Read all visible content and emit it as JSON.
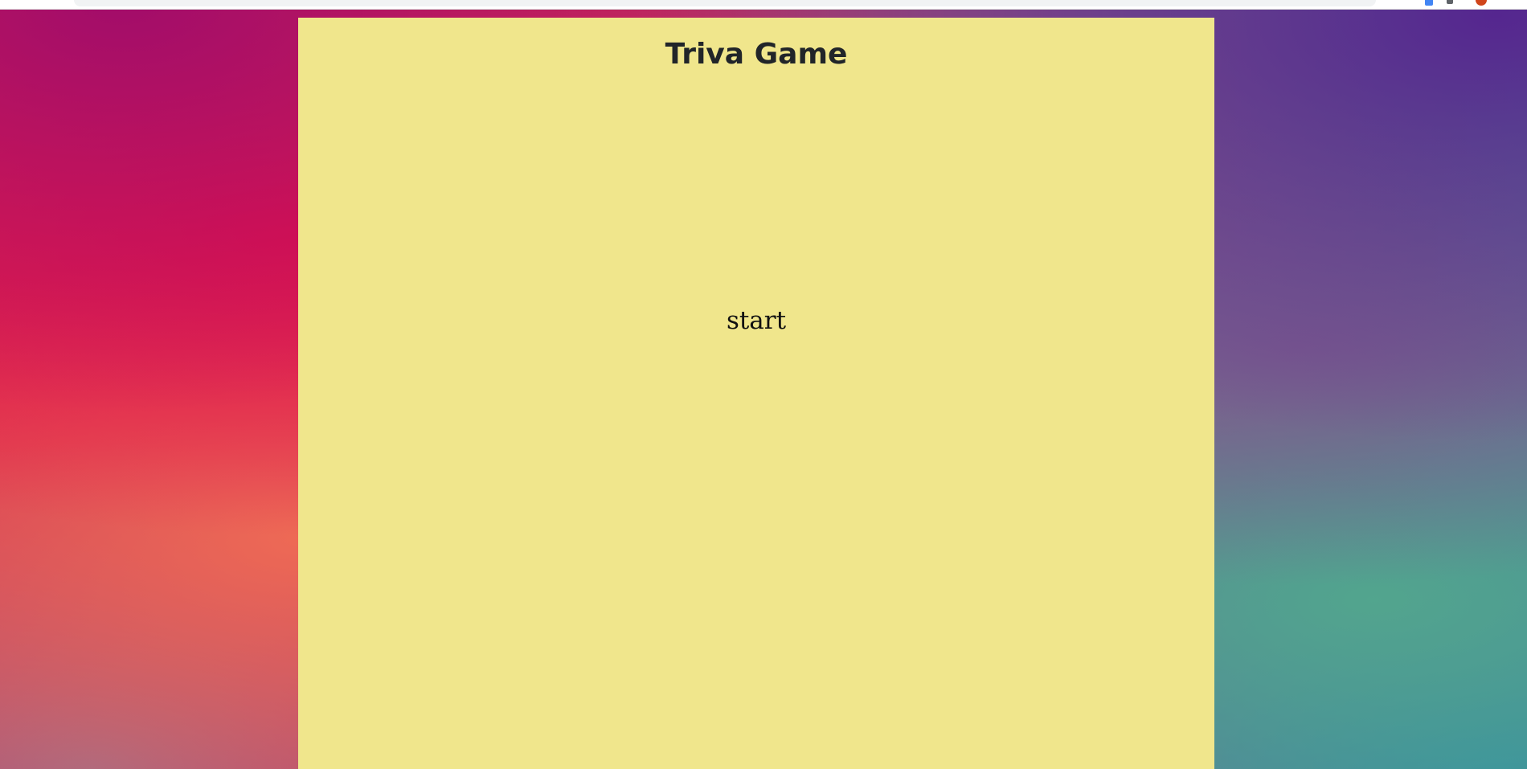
{
  "game": {
    "title": "Triva Game",
    "start_label": "start"
  },
  "colors": {
    "panel_background": "#f0e68c",
    "title_text": "#212529",
    "start_text": "#111111"
  },
  "icons": [
    "extension-icon",
    "extension-icon",
    "profile-icon"
  ]
}
